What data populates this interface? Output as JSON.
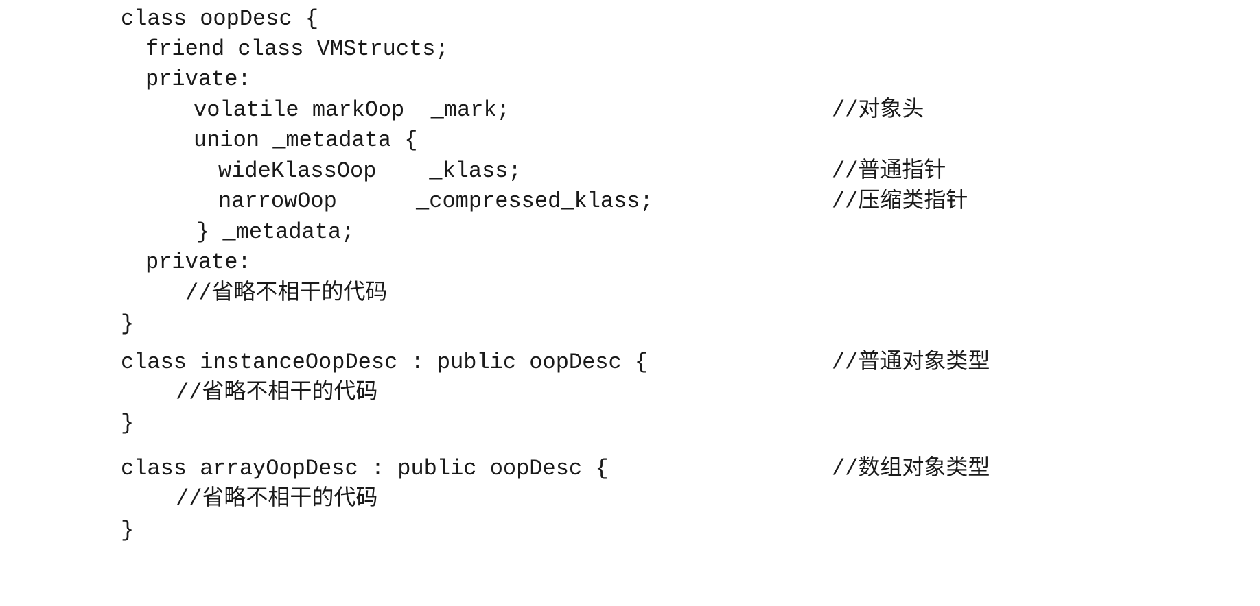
{
  "code": {
    "lines": [
      {
        "text": "class oopDesc {",
        "comment": ""
      },
      {
        "text": "friend class VMStructs;",
        "comment": ""
      },
      {
        "text": "private:",
        "comment": ""
      },
      {
        "text": "volatile markOop  _mark;",
        "comment": "//对象头"
      },
      {
        "text": "union _metadata {",
        "comment": ""
      },
      {
        "text": "wideKlassOop    _klass;",
        "comment": "//普通指针"
      },
      {
        "text": "narrowOop      _compressed_klass;",
        "comment": "//压缩类指针"
      },
      {
        "text": "} _metadata;",
        "comment": ""
      },
      {
        "text": "private:",
        "comment": ""
      },
      {
        "text": "//省略不相干的代码",
        "comment": ""
      },
      {
        "text": "}",
        "comment": ""
      },
      {
        "text": "class instanceOopDesc : public oopDesc {",
        "comment": "//普通对象类型"
      },
      {
        "text": "//省略不相干的代码",
        "comment": ""
      },
      {
        "text": "}",
        "comment": ""
      },
      {
        "text": "class arrayOopDesc : public oopDesc {",
        "comment": "//数组对象类型"
      },
      {
        "text": "//省略不相干的代码",
        "comment": ""
      },
      {
        "text": "}",
        "comment": ""
      }
    ]
  }
}
